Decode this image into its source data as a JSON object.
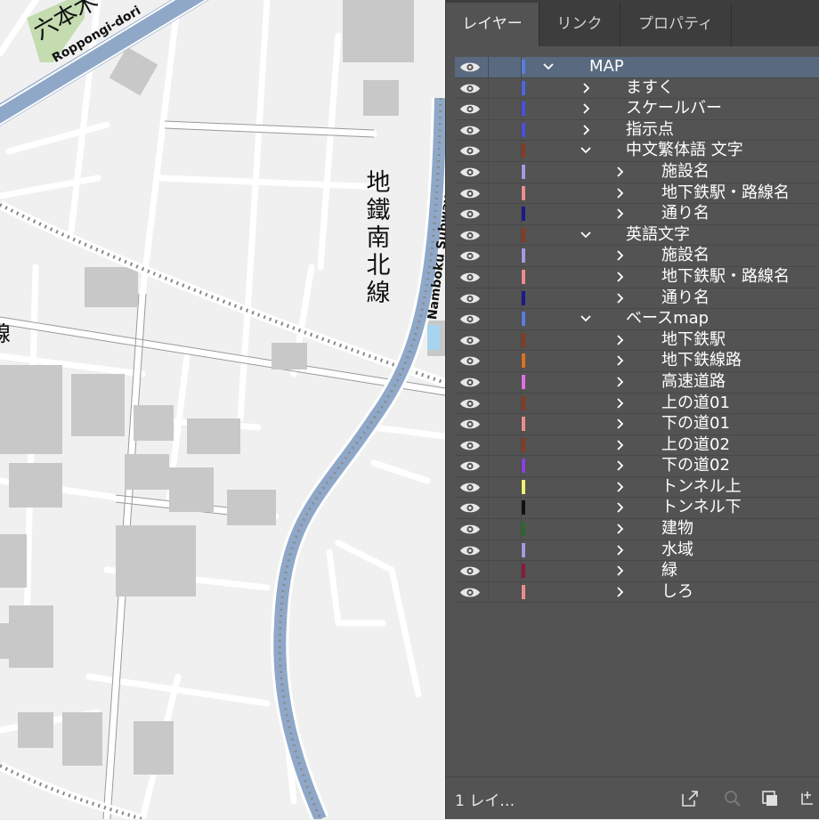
{
  "map": {
    "labels": {
      "roppongi_jp": "六本木",
      "roppongi_en": "Roppongi-dori",
      "namboku_jp": "地鐵南北線",
      "namboku_en": "Namboku Subway",
      "edge_jp": "線"
    }
  },
  "panel": {
    "tabs": [
      {
        "label": "レイヤー",
        "active": true
      },
      {
        "label": "リンク",
        "active": false
      },
      {
        "label": "プロパティ",
        "active": false
      }
    ],
    "layers": [
      {
        "name": "MAP",
        "level": 0,
        "expanded": true,
        "color": "#5b7de0",
        "selected": true
      },
      {
        "name": "ますく",
        "level": 1,
        "expanded": false,
        "color": "#4a66e8"
      },
      {
        "name": "スケールバー",
        "level": 1,
        "expanded": false,
        "color": "#4a50e0"
      },
      {
        "name": "指示点",
        "level": 1,
        "expanded": false,
        "color": "#4a50e0"
      },
      {
        "name": "中文繁体語 文字",
        "level": 1,
        "expanded": true,
        "color": "#8a3a1e"
      },
      {
        "name": "施設名",
        "level": 2,
        "expanded": false,
        "color": "#a59ae0"
      },
      {
        "name": "地下鉄駅・路線名",
        "level": 2,
        "expanded": false,
        "color": "#f08c8c"
      },
      {
        "name": "通り名",
        "level": 2,
        "expanded": false,
        "color": "#1a1a8c"
      },
      {
        "name": "英語文字",
        "level": 1,
        "expanded": true,
        "color": "#8a3a1e"
      },
      {
        "name": "施設名",
        "level": 2,
        "expanded": false,
        "color": "#a59ae0"
      },
      {
        "name": "地下鉄駅・路線名",
        "level": 2,
        "expanded": false,
        "color": "#f08c8c"
      },
      {
        "name": "通り名",
        "level": 2,
        "expanded": false,
        "color": "#1a1a8c"
      },
      {
        "name": "ベースmap",
        "level": 1,
        "expanded": true,
        "color": "#5b7de0"
      },
      {
        "name": "地下鉄駅",
        "level": 2,
        "expanded": false,
        "color": "#8a3a1e"
      },
      {
        "name": "地下鉄線路",
        "level": 2,
        "expanded": false,
        "color": "#e07020"
      },
      {
        "name": "高速道路",
        "level": 2,
        "expanded": false,
        "color": "#e070e0"
      },
      {
        "name": "上の道01",
        "level": 2,
        "expanded": false,
        "color": "#8a3a1e"
      },
      {
        "name": "下の道01",
        "level": 2,
        "expanded": false,
        "color": "#f08c8c"
      },
      {
        "name": "上の道02",
        "level": 2,
        "expanded": false,
        "color": "#8a3a1e"
      },
      {
        "name": "下の道02",
        "level": 2,
        "expanded": false,
        "color": "#8a40e0"
      },
      {
        "name": "トンネル上",
        "level": 2,
        "expanded": false,
        "color": "#f0f070"
      },
      {
        "name": "トンネル下",
        "level": 2,
        "expanded": false,
        "color": "#111111"
      },
      {
        "name": "建物",
        "level": 2,
        "expanded": false,
        "color": "#2a6a2a"
      },
      {
        "name": "水域",
        "level": 2,
        "expanded": false,
        "color": "#a59ae0"
      },
      {
        "name": "緑",
        "level": 2,
        "expanded": false,
        "color": "#8a1a3a"
      },
      {
        "name": "しろ",
        "level": 2,
        "expanded": false,
        "color": "#f08c8c"
      }
    ],
    "footer": {
      "count_text": "1 レイ…",
      "icons": [
        "export-icon",
        "locate-icon",
        "collect-icon",
        "new-layer-icon"
      ]
    }
  }
}
